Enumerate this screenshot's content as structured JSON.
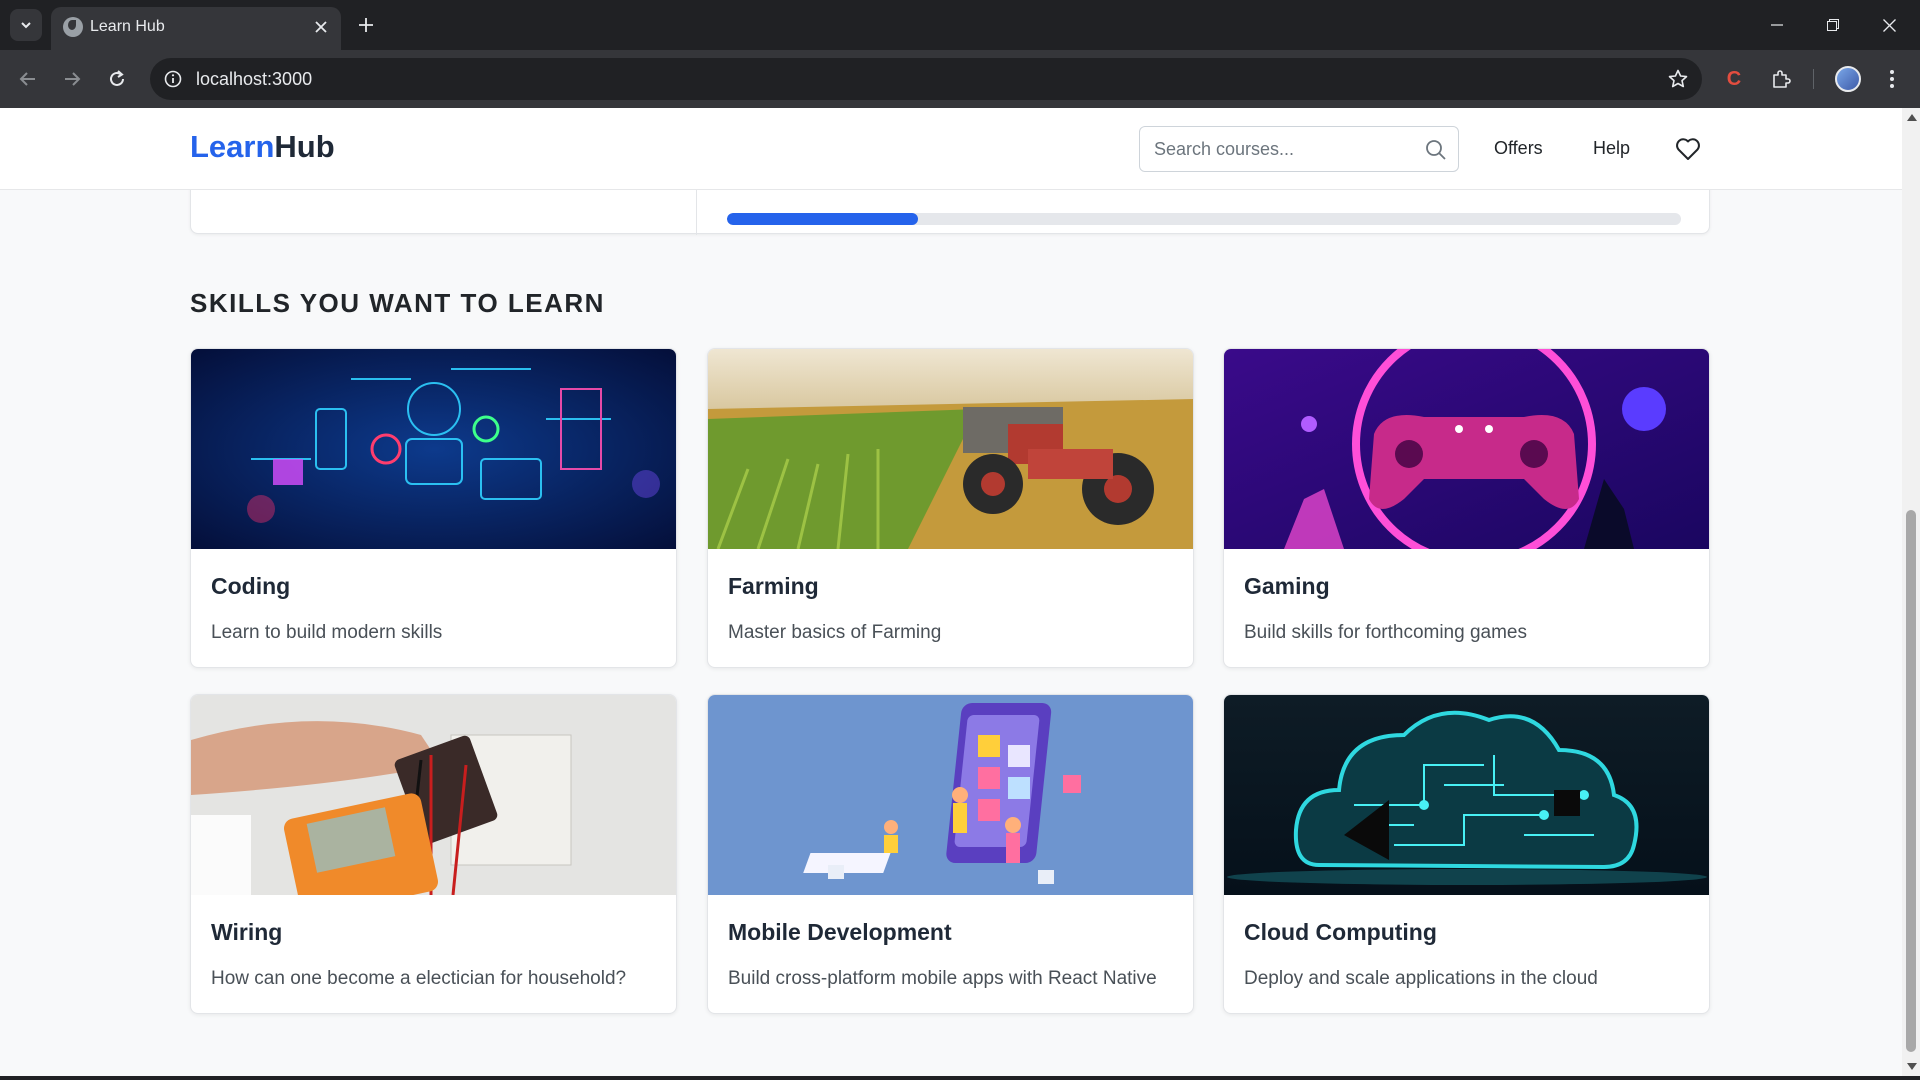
{
  "browser": {
    "tab_title": "Learn Hub",
    "url": "localhost:3000",
    "ext_label": "C"
  },
  "navbar": {
    "brand_part1": "Learn",
    "brand_part2": "Hub",
    "search_placeholder": "Search courses...",
    "links": [
      "Offers",
      "Help"
    ]
  },
  "progress": {
    "percent": 20
  },
  "section": {
    "title": "SKILLS YOU WANT TO LEARN"
  },
  "courses": [
    {
      "title": "Coding",
      "description": "Learn to build modern skills"
    },
    {
      "title": "Farming",
      "description": "Master basics of Farming"
    },
    {
      "title": "Gaming",
      "description": "Build skills for forthcoming games"
    },
    {
      "title": "Wiring",
      "description": "How can one become a electician for household?"
    },
    {
      "title": "Mobile Development",
      "description": "Build cross-platform mobile apps with React Native"
    },
    {
      "title": "Cloud Computing",
      "description": "Deploy and scale applications in the cloud"
    }
  ],
  "colors": {
    "accent": "#2563eb",
    "chrome_dark": "#202124",
    "chrome_toolbar": "#35363a"
  }
}
